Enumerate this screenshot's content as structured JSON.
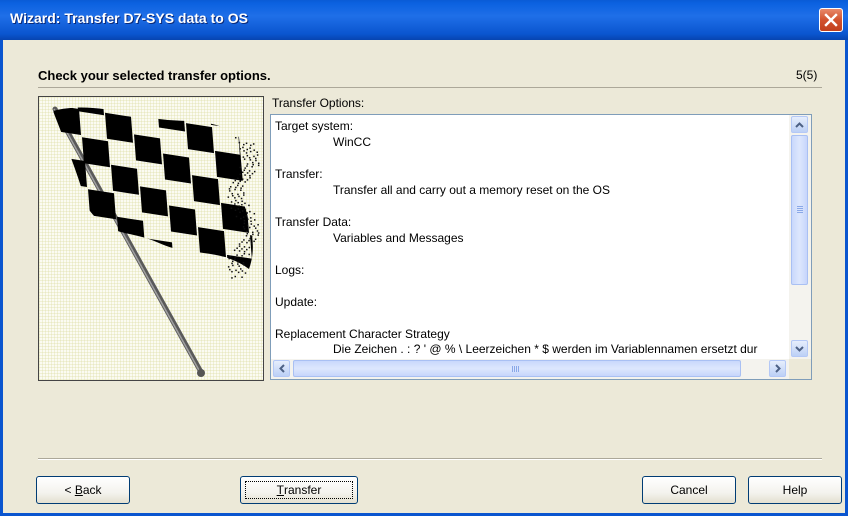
{
  "window": {
    "title": "Wizard: Transfer D7-SYS data to OS"
  },
  "page": {
    "heading": "Check your selected transfer options.",
    "counter": "5(5)",
    "options_label": "Transfer Options:"
  },
  "options": [
    {
      "label": "Target system:",
      "value": "WinCC"
    },
    {
      "label": "Transfer:",
      "value": "Transfer all and carry out a memory reset on the OS"
    },
    {
      "label": "Transfer Data:",
      "value": "Variables and Messages"
    },
    {
      "label": "Logs:",
      "value": ""
    },
    {
      "label": "Update:",
      "value": ""
    },
    {
      "label": "Replacement Character Strategy",
      "value": "Die Zeichen . : ? ' @ % \\ Leerzeichen * $ werden im Variablennamen ersetzt dur"
    }
  ],
  "buttons": {
    "back_prefix": "< ",
    "back_mnemonic": "B",
    "back_rest": "ack",
    "transfer_mnemonic": "T",
    "transfer_rest": "ransfer",
    "cancel": "Cancel",
    "help": "Help"
  },
  "colors": {
    "titlebar": "#0a55cf",
    "dialog_bg": "#ece9d8",
    "close_button": "#d2522e"
  },
  "icons": {
    "close": "close-x-icon",
    "flag": "checkered-flag-image"
  }
}
